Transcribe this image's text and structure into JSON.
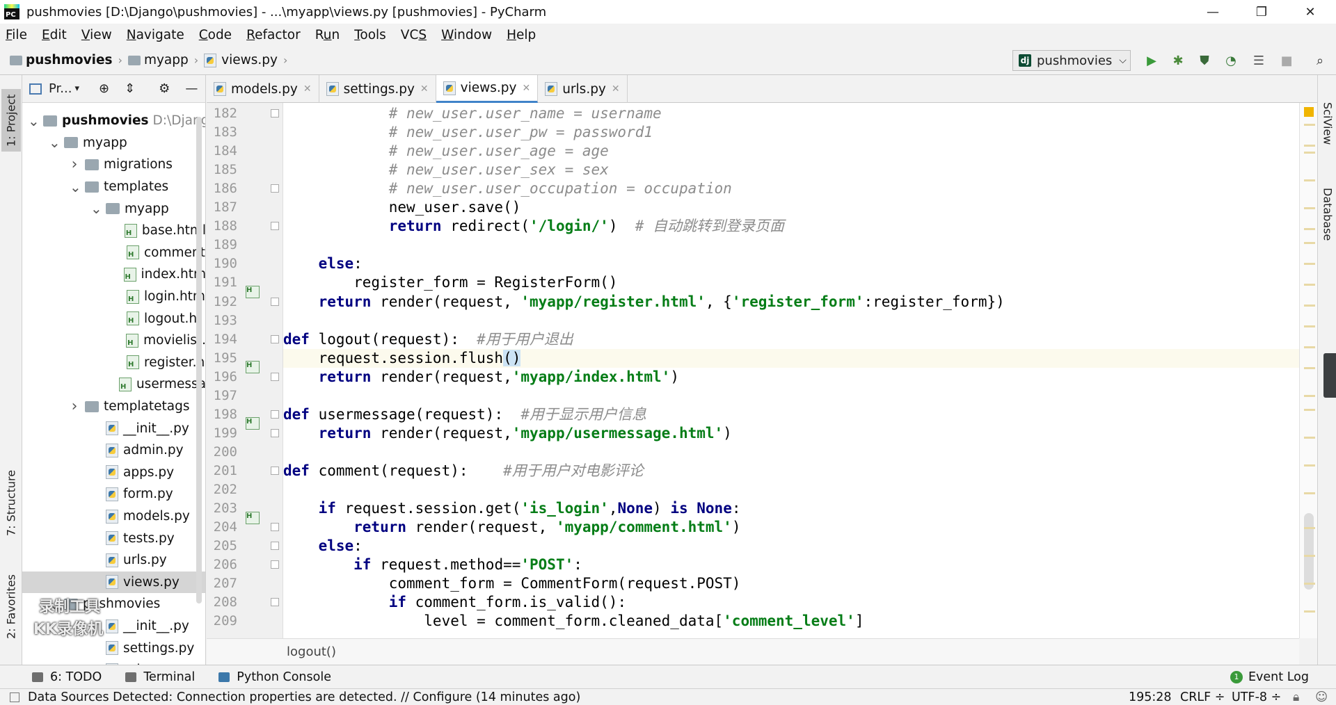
{
  "window": {
    "title": "pushmovies [D:\\Django\\pushmovies] - ...\\myapp\\views.py [pushmovies] - PyCharm",
    "logo_text": "PC",
    "minimize": "—",
    "restore": "❐",
    "close": "✕"
  },
  "menu": [
    {
      "pre": "",
      "u": "F",
      "post": "ile"
    },
    {
      "pre": "",
      "u": "E",
      "post": "dit"
    },
    {
      "pre": "",
      "u": "V",
      "post": "iew"
    },
    {
      "pre": "",
      "u": "N",
      "post": "avigate"
    },
    {
      "pre": "",
      "u": "C",
      "post": "ode"
    },
    {
      "pre": "",
      "u": "R",
      "post": "efactor"
    },
    {
      "pre": "R",
      "u": "u",
      "post": "n"
    },
    {
      "pre": "",
      "u": "T",
      "post": "ools"
    },
    {
      "pre": "VC",
      "u": "S",
      "post": ""
    },
    {
      "pre": "",
      "u": "W",
      "post": "indow"
    },
    {
      "pre": "",
      "u": "H",
      "post": "elp"
    }
  ],
  "navbar": {
    "crumbs": [
      "pushmovies",
      "myapp",
      "views.py"
    ],
    "run_config": "pushmovies",
    "dj": "dj"
  },
  "project": {
    "header": "Pr...",
    "tree": [
      {
        "label": "pushmovies",
        "extra": "D:\\Django",
        "type": "folder",
        "arrow": "down",
        "indent": 0,
        "bold": true
      },
      {
        "label": "myapp",
        "type": "folder",
        "arrow": "down",
        "indent": 1
      },
      {
        "label": "migrations",
        "type": "folder",
        "arrow": "right",
        "indent": 2
      },
      {
        "label": "templates",
        "type": "folder",
        "arrow": "down",
        "indent": 2
      },
      {
        "label": "myapp",
        "type": "folder",
        "arrow": "down",
        "indent": 3
      },
      {
        "label": "base.html",
        "type": "html",
        "indent": 4
      },
      {
        "label": "comment",
        "type": "html",
        "indent": 4
      },
      {
        "label": "index.htm",
        "type": "html",
        "indent": 4
      },
      {
        "label": "login.htm",
        "type": "html",
        "indent": 4
      },
      {
        "label": "logout.ht",
        "type": "html",
        "indent": 4
      },
      {
        "label": "movielist.",
        "type": "html",
        "indent": 4
      },
      {
        "label": "register.h",
        "type": "html",
        "indent": 4
      },
      {
        "label": "usermessa",
        "type": "html",
        "indent": 4
      },
      {
        "label": "templatetags",
        "type": "folder",
        "arrow": "right",
        "indent": 2
      },
      {
        "label": "__init__.py",
        "type": "py",
        "indent": 3
      },
      {
        "label": "admin.py",
        "type": "py",
        "indent": 3
      },
      {
        "label": "apps.py",
        "type": "py",
        "indent": 3
      },
      {
        "label": "form.py",
        "type": "py",
        "indent": 3
      },
      {
        "label": "models.py",
        "type": "py",
        "indent": 3
      },
      {
        "label": "tests.py",
        "type": "py",
        "indent": 3
      },
      {
        "label": "urls.py",
        "type": "py",
        "indent": 3
      },
      {
        "label": "views.py",
        "type": "py",
        "indent": 3,
        "selected": true
      },
      {
        "label": "pushmovies",
        "type": "folder",
        "arrow": "down",
        "indent": 1
      },
      {
        "label": "__init__.py",
        "type": "py",
        "indent": 3
      },
      {
        "label": "settings.py",
        "type": "py",
        "indent": 3
      },
      {
        "label": "urls.py",
        "type": "py",
        "indent": 3
      }
    ]
  },
  "tabs": [
    {
      "label": "models.py",
      "active": false
    },
    {
      "label": "settings.py",
      "active": false
    },
    {
      "label": "views.py",
      "active": true
    },
    {
      "label": "urls.py",
      "active": false
    }
  ],
  "code": {
    "current_line": 195,
    "lines": [
      {
        "n": 182,
        "tokens": [
          [
            "cmt",
            "            # new_user.user_name = username"
          ]
        ]
      },
      {
        "n": 183,
        "tokens": [
          [
            "cmt",
            "            # new_user.user_pw = password1"
          ]
        ]
      },
      {
        "n": 184,
        "tokens": [
          [
            "cmt",
            "            # new_user.user_age = age"
          ]
        ]
      },
      {
        "n": 185,
        "tokens": [
          [
            "cmt",
            "            # new_user.user_sex = sex"
          ]
        ]
      },
      {
        "n": 186,
        "tokens": [
          [
            "cmt",
            "            # new_user.user_occupation = occupation"
          ]
        ]
      },
      {
        "n": 187,
        "tokens": [
          [
            "",
            "            new_user.save()"
          ]
        ]
      },
      {
        "n": 188,
        "tokens": [
          [
            "kw",
            "            return"
          ],
          [
            "",
            " redirect("
          ],
          [
            "str",
            "'/login/'"
          ],
          [
            "",
            ")  "
          ],
          [
            "cmt",
            "# 自动跳转到登录页面"
          ]
        ]
      },
      {
        "n": 189,
        "tokens": [
          [
            "",
            ""
          ]
        ]
      },
      {
        "n": 190,
        "tokens": [
          [
            "kw",
            "    else"
          ],
          [
            "",
            ":"
          ]
        ]
      },
      {
        "n": 191,
        "tokens": [
          [
            "",
            "        register_form = RegisterForm()"
          ]
        ]
      },
      {
        "n": 192,
        "tokens": [
          [
            "kw",
            "    return"
          ],
          [
            "",
            " render(request, "
          ],
          [
            "str",
            "'myapp/register.html'"
          ],
          [
            "",
            ", {"
          ],
          [
            "str",
            "'register_form'"
          ],
          [
            "",
            ":register_form})"
          ]
        ]
      },
      {
        "n": 193,
        "tokens": [
          [
            "",
            ""
          ]
        ]
      },
      {
        "n": 194,
        "tokens": [
          [
            "kw",
            "def"
          ],
          [
            "",
            " logout(request):  "
          ],
          [
            "cmt",
            "#用于用户退出"
          ]
        ]
      },
      {
        "n": 195,
        "tokens": [
          [
            "",
            "    request.session.flush"
          ],
          [
            "caret",
            "()"
          ]
        ]
      },
      {
        "n": 196,
        "tokens": [
          [
            "kw",
            "    return"
          ],
          [
            "",
            " render(request,"
          ],
          [
            "str",
            "'myapp/index.html'"
          ],
          [
            "",
            ")"
          ]
        ]
      },
      {
        "n": 197,
        "tokens": [
          [
            "",
            ""
          ]
        ]
      },
      {
        "n": 198,
        "tokens": [
          [
            "kw",
            "def"
          ],
          [
            "",
            " usermessage(request):  "
          ],
          [
            "cmt",
            "#用于显示用户信息"
          ]
        ]
      },
      {
        "n": 199,
        "tokens": [
          [
            "kw",
            "    return"
          ],
          [
            "",
            " render(request,"
          ],
          [
            "str",
            "'myapp/usermessage.html'"
          ],
          [
            "",
            ")"
          ]
        ]
      },
      {
        "n": 200,
        "tokens": [
          [
            "",
            ""
          ]
        ]
      },
      {
        "n": 201,
        "tokens": [
          [
            "kw",
            "def"
          ],
          [
            "",
            " comment(request):    "
          ],
          [
            "cmt",
            "#用于用户对电影评论"
          ]
        ]
      },
      {
        "n": 202,
        "tokens": [
          [
            "",
            ""
          ]
        ]
      },
      {
        "n": 203,
        "tokens": [
          [
            "kw",
            "    if"
          ],
          [
            "",
            " request.session.get("
          ],
          [
            "str",
            "'is_login'"
          ],
          [
            "",
            ","
          ],
          [
            "kw",
            "None"
          ],
          [
            "",
            ") "
          ],
          [
            "kw",
            "is None"
          ],
          [
            "",
            ":"
          ]
        ]
      },
      {
        "n": 204,
        "tokens": [
          [
            "kw",
            "        return"
          ],
          [
            "",
            " render(request, "
          ],
          [
            "str",
            "'myapp/comment.html'"
          ],
          [
            "",
            ")"
          ]
        ]
      },
      {
        "n": 205,
        "tokens": [
          [
            "kw",
            "    else"
          ],
          [
            "",
            ":"
          ]
        ]
      },
      {
        "n": 206,
        "tokens": [
          [
            "kw",
            "        if"
          ],
          [
            "",
            " request.method=="
          ],
          [
            "str",
            "'POST'"
          ],
          [
            "",
            ":"
          ]
        ]
      },
      {
        "n": 207,
        "tokens": [
          [
            "",
            "            comment_form = CommentForm(request.POST)"
          ]
        ]
      },
      {
        "n": 208,
        "tokens": [
          [
            "kw",
            "            if"
          ],
          [
            "",
            " comment_form.is_valid():"
          ]
        ]
      },
      {
        "n": 209,
        "tokens": [
          [
            "",
            "                level = comment_form.cleaned_data["
          ],
          [
            "str",
            "'comment_level'"
          ],
          [
            "",
            "]"
          ]
        ]
      }
    ]
  },
  "editor_crumb": "logout()",
  "left_tabs": [
    "1: Project",
    "7: Structure",
    "2: Favorites"
  ],
  "right_tabs": [
    "SciView",
    "Database"
  ],
  "tool_tabs": [
    "6: TODO",
    "Terminal",
    "Python Console"
  ],
  "event_log": "Event Log",
  "status": {
    "message": "Data Sources Detected: Connection properties are detected. // Configure (14 minutes ago)",
    "position": "195:28",
    "line_sep": "CRLF ÷",
    "encoding": "UTF-8 ÷"
  },
  "watermark": [
    "录制工具",
    "KK录像机"
  ]
}
